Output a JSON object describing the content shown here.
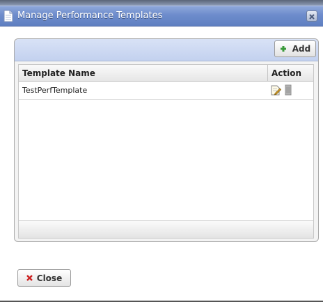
{
  "dialog": {
    "title": "Manage Performance Templates",
    "title_icon": "document-icon",
    "close_icon": "close-x-icon"
  },
  "toolbar": {
    "add_label": "Add",
    "add_icon": "plus-icon"
  },
  "table": {
    "columns": [
      "Template Name",
      "Action"
    ],
    "rows": [
      {
        "name": "TestPerfTemplate",
        "actions": [
          "edit-icon",
          "delete-icon"
        ]
      }
    ]
  },
  "footer": {
    "close_label": "Close",
    "close_icon": "x-icon"
  },
  "colors": {
    "titlebar": "#6d8ccc",
    "toolbar": "#c3d1ef",
    "add_icon": "#3a9a3a",
    "close_icon": "#cc2222"
  }
}
